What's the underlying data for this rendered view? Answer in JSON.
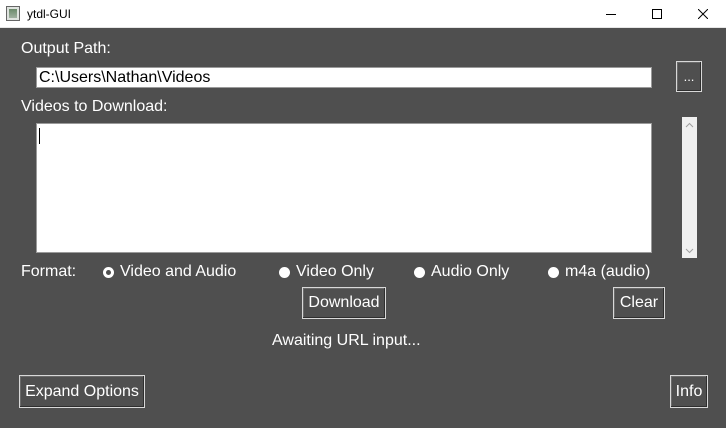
{
  "window": {
    "title": "ytdl-GUI",
    "icon": "ytdl-app-icon",
    "controls": [
      "minimize-icon",
      "maximize-icon",
      "close-icon"
    ]
  },
  "output": {
    "label": "Output Path:",
    "value": "C:\\Users\\Nathan\\Videos",
    "browse_label": "..."
  },
  "videos": {
    "label": "Videos to Download:",
    "value": ""
  },
  "format": {
    "label": "Format:",
    "options": [
      {
        "label": "Video and Audio",
        "selected": true
      },
      {
        "label": "Video Only",
        "selected": false
      },
      {
        "label": "Audio Only",
        "selected": false
      },
      {
        "label": "m4a (audio)",
        "selected": false
      }
    ]
  },
  "actions": {
    "download_label": "Download",
    "clear_label": "Clear",
    "expand_label": "Expand Options",
    "info_label": "Info"
  },
  "status": "Awaiting URL input...",
  "colors": {
    "background": "#4f4f4f",
    "text": "#ffffff",
    "input_background": "#ffffff",
    "titlebar": "#ffffff"
  }
}
